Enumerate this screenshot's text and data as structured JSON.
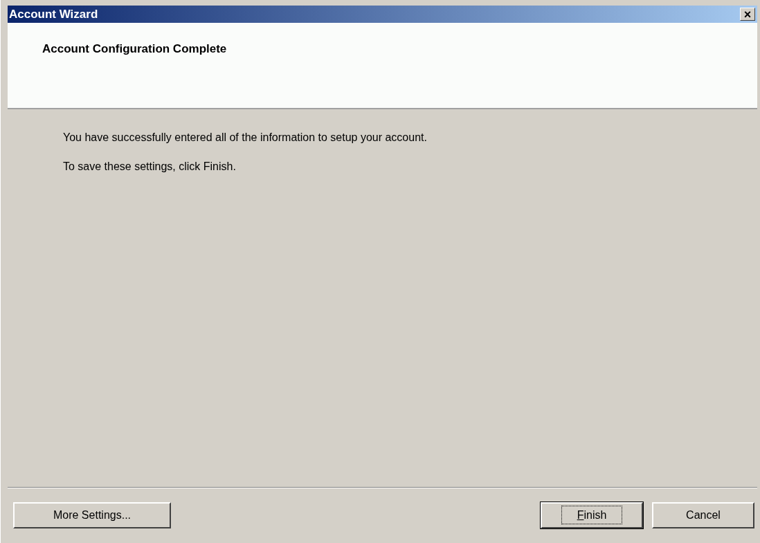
{
  "window": {
    "title": "Account Wizard",
    "close": "×"
  },
  "header": {
    "title": "Account Configuration Complete"
  },
  "body": {
    "paragraphs": [
      "You have successfully entered all of the information to setup your account.",
      "To save these settings, click Finish."
    ]
  },
  "left_buttons": [
    {
      "label": "More Settings...",
      "default": false,
      "mnemonic_first": false
    }
  ],
  "right_buttons": [
    {
      "label": "Finish",
      "default": true,
      "mnemonic_first": true
    },
    {
      "label": "Cancel",
      "default": false,
      "mnemonic_first": false
    }
  ]
}
